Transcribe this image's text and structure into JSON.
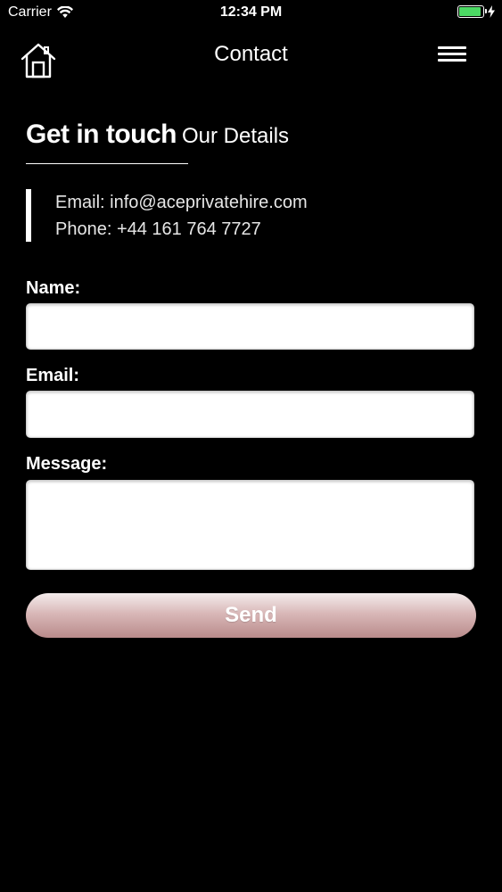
{
  "status_bar": {
    "carrier": "Carrier",
    "time": "12:34 PM",
    "battery_color": "#4cd964"
  },
  "nav": {
    "title": "Contact",
    "home_icon": "home-icon",
    "menu_icon": "hamburger-menu-icon"
  },
  "heading": {
    "primary": "Get in touch",
    "secondary": "Our Details"
  },
  "details": {
    "email": "Email: info@aceprivatehire.com",
    "phone": "Phone: +44 161 764 7727"
  },
  "form": {
    "name_label": "Name:",
    "name_value": "",
    "email_label": "Email:",
    "email_value": "",
    "message_label": "Message:",
    "message_value": "",
    "send_label": "Send"
  }
}
